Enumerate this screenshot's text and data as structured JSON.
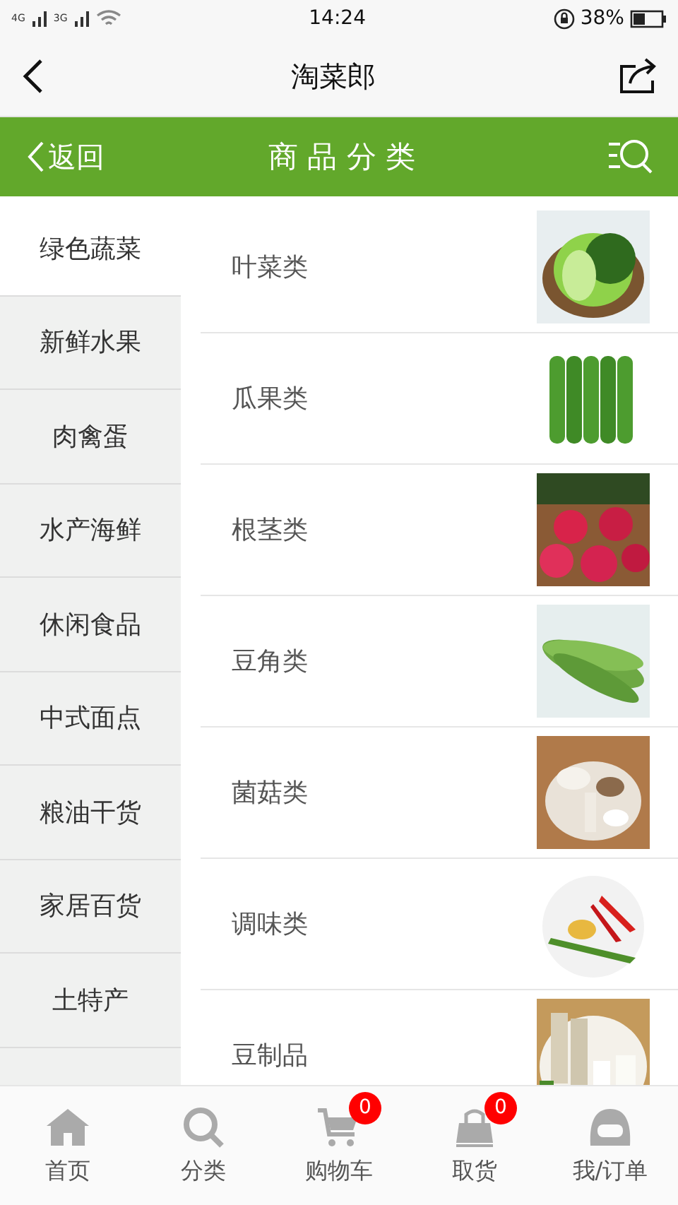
{
  "status_bar": {
    "network_1": "4G",
    "network_2": "3G",
    "time": "14:24",
    "battery": "38%"
  },
  "header": {
    "title": "淘菜郎"
  },
  "category_bar": {
    "back": "返回",
    "title": "商 品 分 类"
  },
  "sidebar": {
    "items": [
      {
        "label": "绿色蔬菜",
        "selected": true
      },
      {
        "label": "新鲜水果",
        "selected": false
      },
      {
        "label": "肉禽蛋",
        "selected": false
      },
      {
        "label": "水产海鲜",
        "selected": false
      },
      {
        "label": "休闲食品",
        "selected": false
      },
      {
        "label": "中式面点",
        "selected": false
      },
      {
        "label": "粮油干货",
        "selected": false
      },
      {
        "label": "家居百货",
        "selected": false
      },
      {
        "label": "土特产",
        "selected": false
      }
    ]
  },
  "products": [
    {
      "label": "叶菜类",
      "kind": "picture"
    },
    {
      "label": "瓜果类",
      "kind": "picture"
    },
    {
      "label": "根茎类",
      "kind": "picture"
    },
    {
      "label": "豆角类",
      "kind": "picture"
    },
    {
      "label": "菌菇类",
      "kind": "picture"
    },
    {
      "label": "调味类",
      "kind": "picture"
    },
    {
      "label": "豆制品",
      "kind": "picture"
    }
  ],
  "tab_bar": [
    {
      "label": "首页",
      "kind": "home"
    },
    {
      "label": "分类",
      "kind": "search"
    },
    {
      "label": "购物车",
      "kind": "cart",
      "badge": "0"
    },
    {
      "label": "取货",
      "kind": "bag",
      "badge": "0"
    },
    {
      "label": "我/订单",
      "kind": "user"
    }
  ]
}
